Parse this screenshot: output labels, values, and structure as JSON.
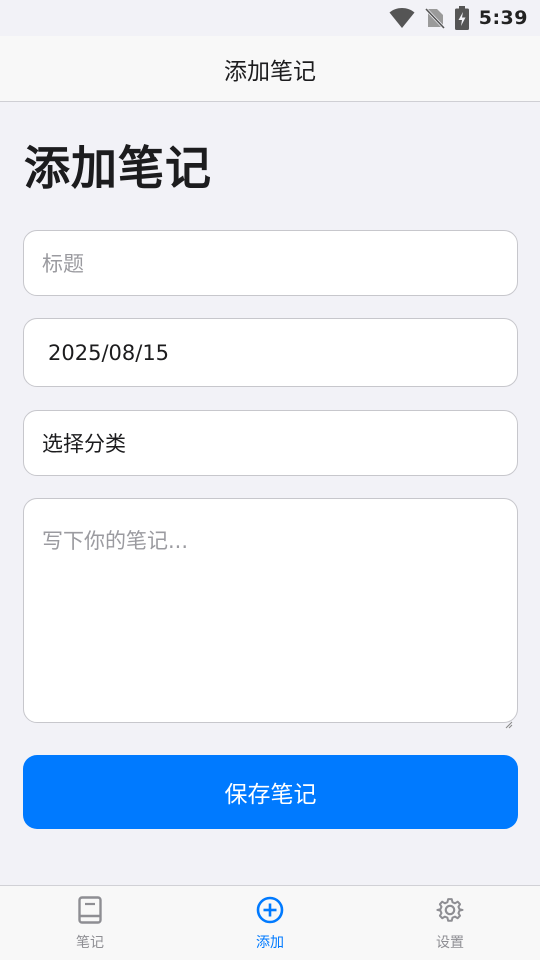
{
  "status_bar": {
    "time": "5:39",
    "icons": [
      "wifi-icon",
      "no-sim-icon",
      "battery-charging-icon"
    ]
  },
  "nav": {
    "title": "添加笔记"
  },
  "page": {
    "heading": "添加笔记"
  },
  "form": {
    "title_placeholder": "标题",
    "date_value": "2025/08/15",
    "category_value": "选择分类",
    "note_placeholder": "写下你的笔记..."
  },
  "save_button_label": "保存笔记",
  "tab_bar": {
    "items": [
      {
        "label": "笔记",
        "icon": "book-icon",
        "active": false
      },
      {
        "label": "添加",
        "icon": "plus-circle-icon",
        "active": true
      },
      {
        "label": "设置",
        "icon": "gear-icon",
        "active": false
      }
    ]
  },
  "colors": {
    "accent": "#007aff",
    "background": "#f2f2f7",
    "inactive": "#8e8e93"
  }
}
